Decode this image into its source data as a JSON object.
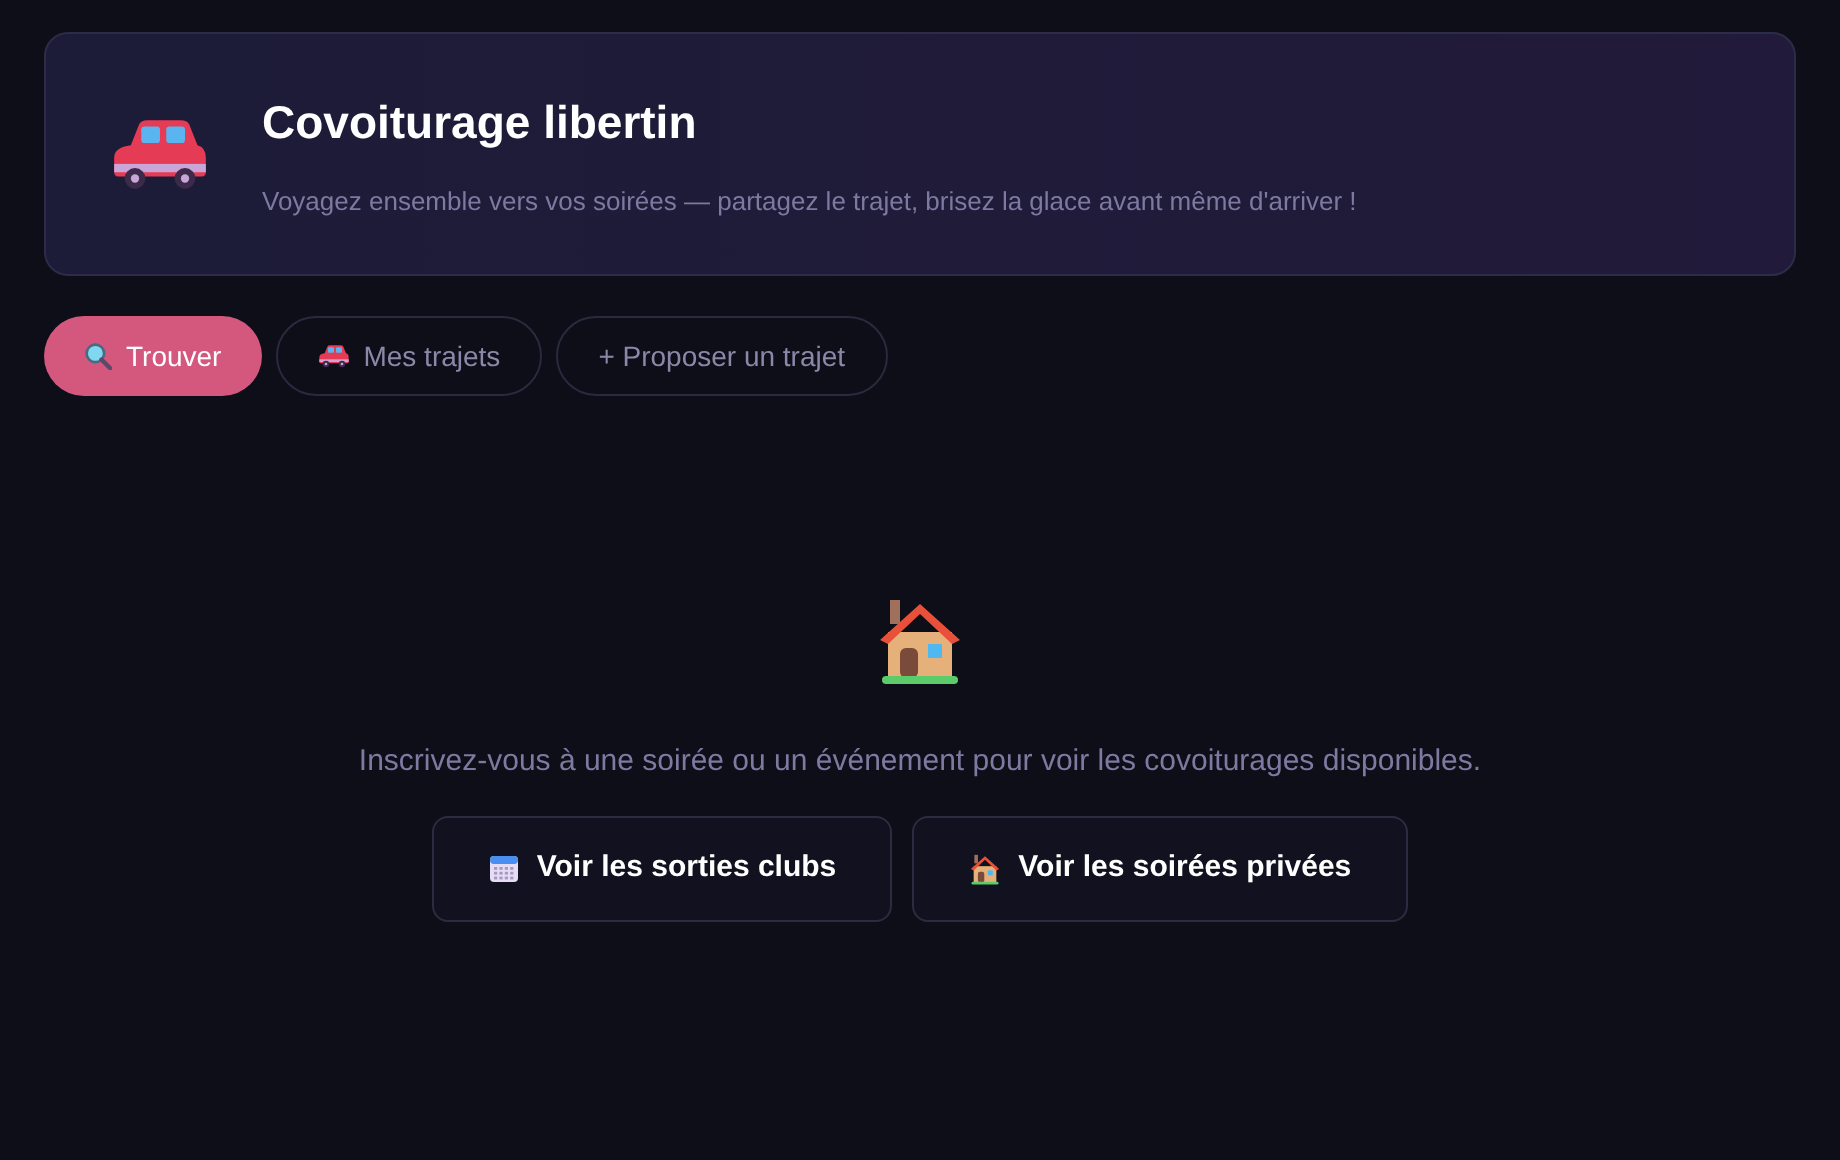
{
  "header": {
    "title": "Covoiturage libertin",
    "subtitle": "Voyagez ensemble vers vos soirées — partagez le trajet, brisez la glace avant même d'arriver !"
  },
  "tabs": [
    {
      "label": "Trouver",
      "selected": true
    },
    {
      "label": "Mes trajets",
      "selected": false
    },
    {
      "label": "+ Proposer un trajet",
      "selected": false
    }
  ],
  "empty_state": {
    "message": "Inscrivez-vous à une soirée ou un événement pour voir les covoiturages disponibles.",
    "buttons": [
      {
        "label": "Voir les sorties clubs"
      },
      {
        "label": "Voir les soirées privées"
      }
    ]
  }
}
